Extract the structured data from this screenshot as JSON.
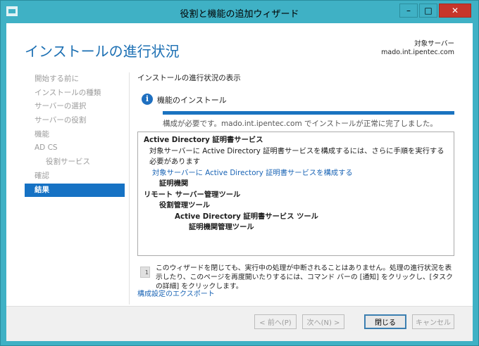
{
  "window": {
    "title": "役割と機能の追加ウィザード",
    "minimize": "–",
    "maximize": "□",
    "close": "✕"
  },
  "header": {
    "page_title": "インストールの進行状況",
    "target_server_label": "対象サーバー",
    "target_server_name": "mado.int.ipentec.com"
  },
  "nav": {
    "items": [
      {
        "label": "開始する前に",
        "state": "disabled"
      },
      {
        "label": "インストールの種類",
        "state": "disabled"
      },
      {
        "label": "サーバーの選択",
        "state": "disabled"
      },
      {
        "label": "サーバーの役割",
        "state": "disabled"
      },
      {
        "label": "機能",
        "state": "disabled"
      },
      {
        "label": "AD CS",
        "state": "disabled"
      },
      {
        "label": "役割サービス",
        "state": "disabled"
      },
      {
        "label": "確認",
        "state": "disabled"
      },
      {
        "label": "結果",
        "state": "active"
      }
    ]
  },
  "content": {
    "section_heading": "インストールの進行状況の表示",
    "feature_install_label": "機能のインストール",
    "progress_fraction": 1.0,
    "status_text": "構成が必要です。mado.int.ipentec.com でインストールが正常に完了しました。",
    "results": {
      "line1": "Active Directory 証明書サービス",
      "line2": "対象サーバーに Active Directory 証明書サービスを構成するには、さらに手順を実行する必要があります",
      "link": "対象サーバーに Active Directory 証明書サービスを構成する",
      "line4": "証明機関",
      "line5": "リモート サーバー管理ツール",
      "line6": "役割管理ツール",
      "line7": "Active Directory 証明書サービス ツール",
      "line8": "証明機関管理ツール"
    },
    "note": "このウィザードを閉じても、実行中の処理が中断されることはありません。処理の進行状況を表示したり、このページを再度開いたりするには、コマンド バーの [通知] をクリックし、[タスクの詳細] をクリックします。",
    "export_link": "構成設定のエクスポート"
  },
  "footer": {
    "prev": "< 前へ(P)",
    "next": "次へ(N) >",
    "close": "閉じる",
    "cancel": "キャンセル"
  },
  "colors": {
    "window_frame": "#3fb1c5",
    "accent": "#1672c4",
    "title_blue": "#1b6fb3",
    "link": "#1a64b5",
    "close_button": "#c7362b"
  }
}
